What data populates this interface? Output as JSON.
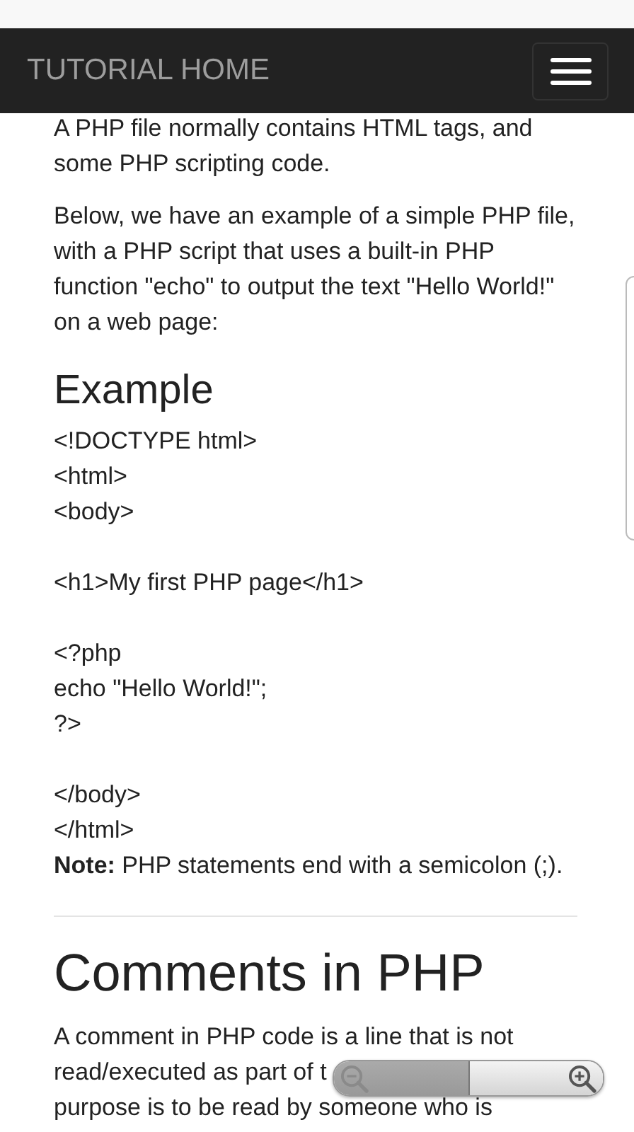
{
  "navbar": {
    "title": "TUTORIAL HOME"
  },
  "paragraphs": [
    "A PHP file normally contains HTML tags, and some PHP scripting code.",
    "Below, we have an example of a simple PHP file, with a PHP script that uses a built-in PHP function \"echo\" to output the text \"Hello World!\" on a web page:"
  ],
  "example_heading": "Example",
  "code_groups": [
    [
      "<!DOCTYPE html>",
      "<html>",
      "<body>"
    ],
    [
      "<h1>My first PHP page</h1>"
    ],
    [
      "<?php",
      "echo \"Hello World!\";",
      "?>"
    ],
    [
      "</body>",
      "</html>"
    ]
  ],
  "note": "**Note:** PHP statements end with a semicolon (;).",
  "section_heading": "Comments in PHP",
  "section_lines": [
    "A comment in PHP code is a line that is not",
    "read/executed as part of t",
    "purpose is to be read by someone who is"
  ]
}
